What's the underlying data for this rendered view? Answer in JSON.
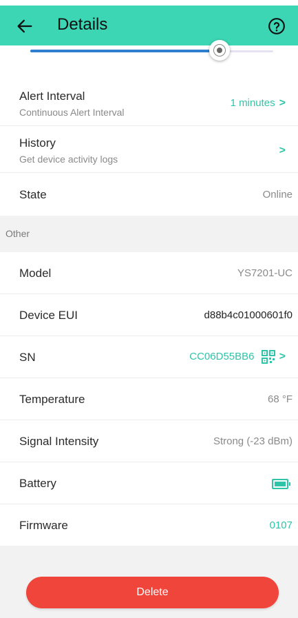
{
  "header": {
    "title": "Details",
    "back_icon": "arrow-left-icon",
    "help_icon": "help-circle-icon",
    "bg_color": "#3cd6b4"
  },
  "slider": {
    "level_fraction": 0.78
  },
  "alert_interval": {
    "label": "Alert Interval",
    "sub": "Continuous Alert Interval",
    "value": "1 minutes"
  },
  "history": {
    "label": "History",
    "sub": "Get device activity logs"
  },
  "state": {
    "label": "State",
    "value": "Online"
  },
  "section_other": "Other",
  "model": {
    "label": "Model",
    "value": "YS7201-UC"
  },
  "device_eui": {
    "label": "Device EUI",
    "value": "d88b4c01000601f0"
  },
  "sn": {
    "label": "SN",
    "value": "CC06D55BB6"
  },
  "temperature": {
    "label": "Temperature",
    "value": "68 °F"
  },
  "signal": {
    "label": "Signal Intensity",
    "value": "Strong (-23 dBm)"
  },
  "battery": {
    "label": "Battery",
    "icon": "battery-full-icon"
  },
  "firmware": {
    "label": "Firmware",
    "value": "0107"
  },
  "delete_label": "Delete",
  "colors": {
    "accent": "#2ec4a8",
    "danger": "#f0453b",
    "slider": "#2f7fd0"
  }
}
